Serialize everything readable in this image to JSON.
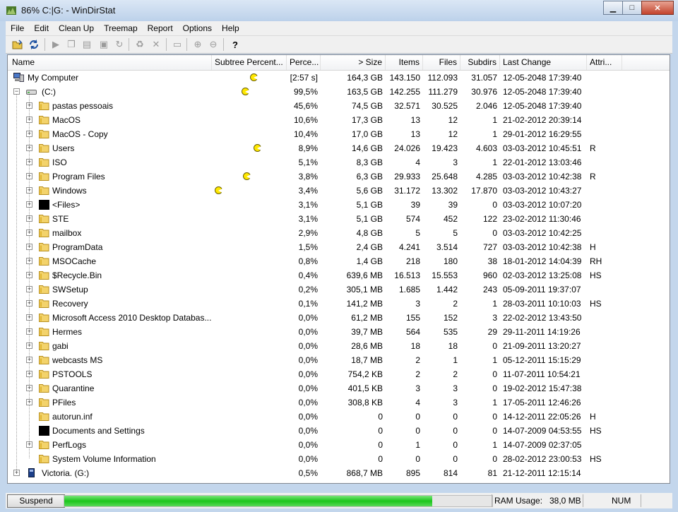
{
  "window": {
    "title": "86% C:|G: - WinDirStat",
    "minimize": "▁",
    "maximize": "□",
    "close": "✕"
  },
  "menu": [
    "File",
    "Edit",
    "Clean Up",
    "Treemap",
    "Report",
    "Options",
    "Help"
  ],
  "toolbar": {
    "icons": [
      "open-icon",
      "refresh-icon",
      "play-icon",
      "copy-icon",
      "explorer-icon",
      "cmd-icon",
      "refresh-selected-icon",
      "recycle-icon",
      "delete-icon",
      "new-folder-icon",
      "zoom-in-icon",
      "zoom-out-icon",
      "help-icon"
    ]
  },
  "columns": [
    {
      "key": "name",
      "label": "Name"
    },
    {
      "key": "subtree",
      "label": "Subtree Percent..."
    },
    {
      "key": "percent",
      "label": "Perce..."
    },
    {
      "key": "size",
      "label": "> Size"
    },
    {
      "key": "items",
      "label": "Items"
    },
    {
      "key": "files",
      "label": "Files"
    },
    {
      "key": "subdirs",
      "label": "Subdirs"
    },
    {
      "key": "last_change",
      "label": "Last Change"
    },
    {
      "key": "attributes",
      "label": "Attri..."
    }
  ],
  "rows": [
    {
      "level": 0,
      "expander": "",
      "icon": "computer-icon",
      "name": "My Computer",
      "pacman": 0.83,
      "percent": "[2:57 s]",
      "size": "164,3 GB",
      "items": "143.150",
      "files": "112.093",
      "subdirs": "31.057",
      "last_change": "12-05-2048  17:39:40",
      "attr": ""
    },
    {
      "level": 1,
      "expander": "−",
      "icon": "drive-icon",
      "name": "(C:)",
      "pacman": 0.63,
      "percent": "99,5%",
      "size": "163,5 GB",
      "items": "142.255",
      "files": "111.279",
      "subdirs": "30.976",
      "last_change": "12-05-2048  17:39:40",
      "attr": ""
    },
    {
      "level": 2,
      "expander": "+",
      "icon": "folder-icon",
      "name": "pastas pessoais",
      "percent": "45,6%",
      "size": "74,5 GB",
      "items": "32.571",
      "files": "30.525",
      "subdirs": "2.046",
      "last_change": "12-05-2048  17:39:40",
      "attr": ""
    },
    {
      "level": 2,
      "expander": "+",
      "icon": "folder-icon",
      "name": "MacOS",
      "percent": "10,6%",
      "size": "17,3 GB",
      "items": "13",
      "files": "12",
      "subdirs": "1",
      "last_change": "21-02-2012  20:39:14",
      "attr": ""
    },
    {
      "level": 2,
      "expander": "+",
      "icon": "folder-icon",
      "name": "MacOS - Copy",
      "percent": "10,4%",
      "size": "17,0 GB",
      "items": "13",
      "files": "12",
      "subdirs": "1",
      "last_change": "29-01-2012  16:29:55",
      "attr": ""
    },
    {
      "level": 2,
      "expander": "+",
      "icon": "folder-icon",
      "name": "Users",
      "pacman": 0.92,
      "percent": "8,9%",
      "size": "14,6 GB",
      "items": "24.026",
      "files": "19.423",
      "subdirs": "4.603",
      "last_change": "03-03-2012  10:45:51",
      "attr": "R"
    },
    {
      "level": 2,
      "expander": "+",
      "icon": "folder-icon",
      "name": "ISO",
      "percent": "5,1%",
      "size": "8,3 GB",
      "items": "4",
      "files": "3",
      "subdirs": "1",
      "last_change": "22-01-2012  13:03:46",
      "attr": ""
    },
    {
      "level": 2,
      "expander": "+",
      "icon": "folder-icon",
      "name": "Program Files",
      "pacman": 0.67,
      "percent": "3,8%",
      "size": "6,3 GB",
      "items": "29.933",
      "files": "25.648",
      "subdirs": "4.285",
      "last_change": "03-03-2012  10:42:38",
      "attr": "R"
    },
    {
      "level": 2,
      "expander": "+",
      "icon": "folder-icon",
      "name": "Windows",
      "pacman": 0.0,
      "percent": "3,4%",
      "size": "5,6 GB",
      "items": "31.172",
      "files": "13.302",
      "subdirs": "17.870",
      "last_change": "03-03-2012  10:43:27",
      "attr": ""
    },
    {
      "level": 2,
      "expander": "+",
      "icon": "files-icon",
      "name": "<Files>",
      "percent": "3,1%",
      "size": "5,1 GB",
      "items": "39",
      "files": "39",
      "subdirs": "0",
      "last_change": "03-03-2012  10:07:20",
      "attr": ""
    },
    {
      "level": 2,
      "expander": "+",
      "icon": "folder-icon",
      "name": "STE",
      "percent": "3,1%",
      "size": "5,1 GB",
      "items": "574",
      "files": "452",
      "subdirs": "122",
      "last_change": "23-02-2012  11:30:46",
      "attr": ""
    },
    {
      "level": 2,
      "expander": "+",
      "icon": "folder-icon",
      "name": "mailbox",
      "percent": "2,9%",
      "size": "4,8 GB",
      "items": "5",
      "files": "5",
      "subdirs": "0",
      "last_change": "03-03-2012  10:42:25",
      "attr": ""
    },
    {
      "level": 2,
      "expander": "+",
      "icon": "folder-icon",
      "name": "ProgramData",
      "percent": "1,5%",
      "size": "2,4 GB",
      "items": "4.241",
      "files": "3.514",
      "subdirs": "727",
      "last_change": "03-03-2012  10:42:38",
      "attr": "H"
    },
    {
      "level": 2,
      "expander": "+",
      "icon": "folder-icon",
      "name": "MSOCache",
      "percent": "0,8%",
      "size": "1,4 GB",
      "items": "218",
      "files": "180",
      "subdirs": "38",
      "last_change": "18-01-2012  14:04:39",
      "attr": "RH"
    },
    {
      "level": 2,
      "expander": "+",
      "icon": "folder-icon",
      "name": "$Recycle.Bin",
      "percent": "0,4%",
      "size": "639,6 MB",
      "items": "16.513",
      "files": "15.553",
      "subdirs": "960",
      "last_change": "02-03-2012  13:25:08",
      "attr": "HS"
    },
    {
      "level": 2,
      "expander": "+",
      "icon": "folder-icon",
      "name": "SWSetup",
      "percent": "0,2%",
      "size": "305,1 MB",
      "items": "1.685",
      "files": "1.442",
      "subdirs": "243",
      "last_change": "05-09-2011  19:37:07",
      "attr": ""
    },
    {
      "level": 2,
      "expander": "+",
      "icon": "folder-icon",
      "name": "Recovery",
      "percent": "0,1%",
      "size": "141,2 MB",
      "items": "3",
      "files": "2",
      "subdirs": "1",
      "last_change": "28-03-2011  10:10:03",
      "attr": "HS"
    },
    {
      "level": 2,
      "expander": "+",
      "icon": "folder-icon",
      "name": "Microsoft Access 2010 Desktop Databas...",
      "percent": "0,0%",
      "size": "61,2 MB",
      "items": "155",
      "files": "152",
      "subdirs": "3",
      "last_change": "22-02-2012  13:43:50",
      "attr": ""
    },
    {
      "level": 2,
      "expander": "+",
      "icon": "folder-icon",
      "name": "Hermes",
      "percent": "0,0%",
      "size": "39,7 MB",
      "items": "564",
      "files": "535",
      "subdirs": "29",
      "last_change": "29-11-2011  14:19:26",
      "attr": ""
    },
    {
      "level": 2,
      "expander": "+",
      "icon": "folder-icon",
      "name": "gabi",
      "percent": "0,0%",
      "size": "28,6 MB",
      "items": "18",
      "files": "18",
      "subdirs": "0",
      "last_change": "21-09-2011  13:20:27",
      "attr": ""
    },
    {
      "level": 2,
      "expander": "+",
      "icon": "folder-icon",
      "name": "webcasts MS",
      "percent": "0,0%",
      "size": "18,7 MB",
      "items": "2",
      "files": "1",
      "subdirs": "1",
      "last_change": "05-12-2011  15:15:29",
      "attr": ""
    },
    {
      "level": 2,
      "expander": "+",
      "icon": "folder-icon",
      "name": "PSTOOLS",
      "percent": "0,0%",
      "size": "754,2 KB",
      "items": "2",
      "files": "2",
      "subdirs": "0",
      "last_change": "11-07-2011  10:54:21",
      "attr": ""
    },
    {
      "level": 2,
      "expander": "+",
      "icon": "folder-icon",
      "name": "Quarantine",
      "percent": "0,0%",
      "size": "401,5 KB",
      "items": "3",
      "files": "3",
      "subdirs": "0",
      "last_change": "19-02-2012  15:47:38",
      "attr": ""
    },
    {
      "level": 2,
      "expander": "+",
      "icon": "folder-icon",
      "name": "PFiles",
      "percent": "0,0%",
      "size": "308,8 KB",
      "items": "4",
      "files": "3",
      "subdirs": "1",
      "last_change": "17-05-2011  12:46:26",
      "attr": ""
    },
    {
      "level": 2,
      "expander": "",
      "icon": "folder-icon",
      "name": "autorun.inf",
      "percent": "0,0%",
      "size": "0",
      "items": "0",
      "files": "0",
      "subdirs": "0",
      "last_change": "14-12-2011  22:05:26",
      "attr": "H"
    },
    {
      "level": 2,
      "expander": "",
      "icon": "files-icon",
      "name": "Documents and Settings",
      "percent": "0,0%",
      "size": "0",
      "items": "0",
      "files": "0",
      "subdirs": "0",
      "last_change": "14-07-2009  04:53:55",
      "attr": "HS"
    },
    {
      "level": 2,
      "expander": "+",
      "icon": "folder-icon",
      "name": "PerfLogs",
      "percent": "0,0%",
      "size": "0",
      "items": "1",
      "files": "0",
      "subdirs": "1",
      "last_change": "14-07-2009  02:37:05",
      "attr": ""
    },
    {
      "level": 2,
      "expander": "",
      "icon": "folder-icon",
      "name": "System Volume Information",
      "percent": "0,0%",
      "size": "0",
      "items": "0",
      "files": "0",
      "subdirs": "0",
      "last_change": "28-02-2012  23:00:53",
      "attr": "HS"
    },
    {
      "level": 1,
      "expander": "+",
      "icon": "removable-drive-icon",
      "name": "Victoria. (G:)",
      "percent": "0,5%",
      "size": "868,7 MB",
      "items": "895",
      "files": "814",
      "subdirs": "81",
      "last_change": "21-12-2011  12:15:14",
      "attr": ""
    }
  ],
  "status": {
    "suspend": "Suspend",
    "progress": 0.86,
    "ram_label": "RAM Usage:",
    "ram_value": "38,0 MB",
    "num": "NUM"
  },
  "colors": {
    "pacman": "#ffe800",
    "progress": "#1cc61c",
    "folder": "#f3d36b"
  }
}
